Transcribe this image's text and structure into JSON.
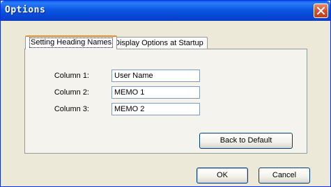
{
  "window": {
    "title": "Options"
  },
  "tabs": [
    {
      "label": "Setting Heading Names",
      "active": true
    },
    {
      "label": "Display Options at Startup",
      "active": false
    }
  ],
  "columns": [
    {
      "label": "Column 1:",
      "value": "User Name"
    },
    {
      "label": "Column 2:",
      "value": "MEMO 1"
    },
    {
      "label": "Column 3:",
      "value": "MEMO 2"
    }
  ],
  "buttons": {
    "back_to_default": "Back to Default",
    "ok": "OK",
    "cancel": "Cancel"
  },
  "colors": {
    "titlebar": "#0a58e4",
    "dialog_bg": "#ece9d8",
    "active_tab_accent": "#e68b2c",
    "close_button": "#d24d2a"
  },
  "icons": {
    "close": "close-icon"
  }
}
